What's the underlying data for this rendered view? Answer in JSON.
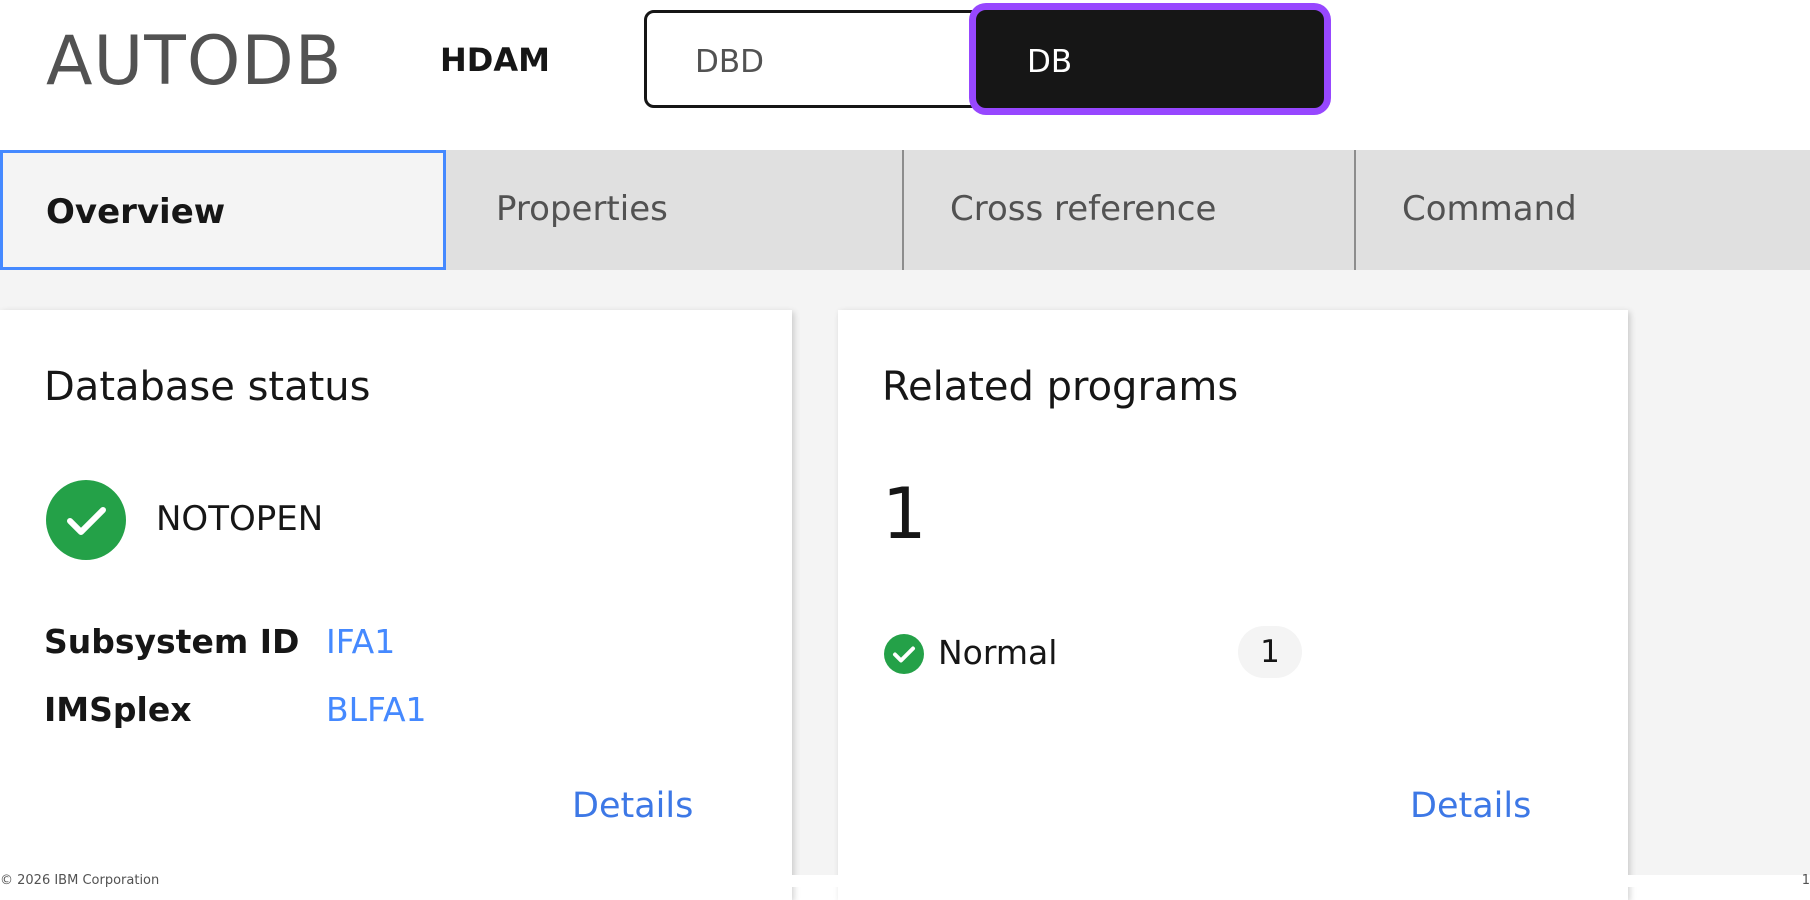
{
  "header": {
    "app_title": "AUTODB",
    "db_type": "HDAM",
    "switcher": {
      "dbd_label": "DBD",
      "db_label": "DB"
    }
  },
  "tabs": [
    {
      "label": "Overview",
      "active": true
    },
    {
      "label": "Properties",
      "active": false
    },
    {
      "label": "Cross reference",
      "active": false
    },
    {
      "label": "Command",
      "active": false
    }
  ],
  "status_card": {
    "title": "Database status",
    "status_icon": "checkmark-circle-icon",
    "status": "NOTOPEN",
    "subsystem_label": "Subsystem ID",
    "subsystem_value": "IFA1",
    "imsplex_label": "IMSplex",
    "imsplex_value": "BLFA1",
    "details_label": "Details"
  },
  "programs_card": {
    "title": "Related programs",
    "total": "1",
    "normal_icon": "checkmark-circle-icon",
    "normal_label": "Normal",
    "normal_count": "1",
    "details_label": "Details"
  },
  "footer": {
    "copyright": "© 2026 IBM Corporation",
    "page_number": "1"
  },
  "colors": {
    "accent_link": "#4589ff",
    "focus_ring": "#9747ff",
    "success": "#24a148",
    "selected_button": "#161616"
  }
}
